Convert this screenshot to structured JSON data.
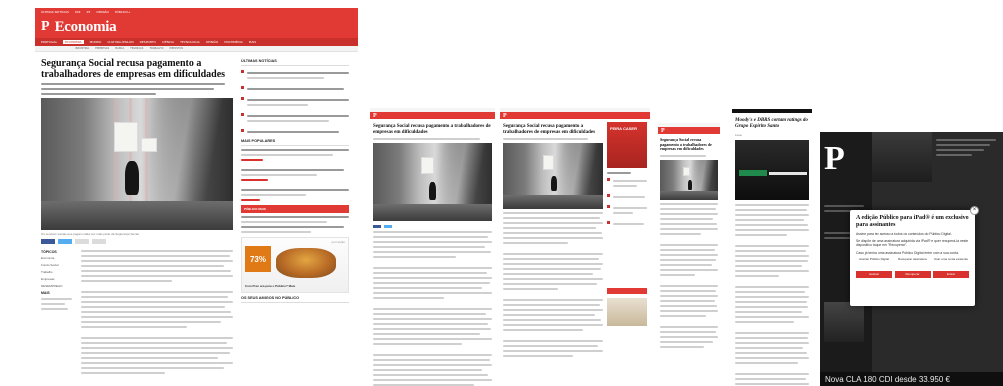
{
  "desktop": {
    "topbar": [
      "ÚLTIMAS NOTÍCIAS",
      "P24",
      "P3",
      "OPINIÃO",
      "PÚBLICO+"
    ],
    "logo": "P",
    "section": "Economia",
    "nav": [
      "PORTUGAL",
      "ECONOMIA",
      "MUNDO",
      "CULTURA-ÍPSILON",
      "DESPORTO",
      "CIÊNCIA",
      "TECNOLOGIA",
      "OPINIÃO",
      "MULTIMÉDIA",
      "MAIS"
    ],
    "subnav": [
      "INDÚSTRIA",
      "EMPRESAS",
      "BANCA",
      "FINANÇAS",
      "TRABALHO",
      "IMPOSTOS"
    ],
    "article": {
      "title": "Segurança Social recusa pagamento a trabalhadores de empresas em dificuldades",
      "caption": "Os serviços sociais que pagam cada vez mais parte da Segurança Social"
    },
    "tags_label": "TÓPICOS",
    "tags": [
      "Economia",
      "Fundo Social",
      "Trabalho",
      "Empresas",
      "DESEMPREGO"
    ],
    "more_label": "MAIS",
    "sidebar": {
      "latest_label": "ÚLTIMAS NOTÍCIAS",
      "popular_label": "MAIS POPULARES",
      "promo_label": "PÚBLICO MAIS",
      "ad": {
        "percent": "73%",
        "tag": "promoção",
        "text": "Com Pren ara para o Público? Mais"
      },
      "bottom_label": "OS SEUS AMIGOS NO PÚBLICO"
    }
  },
  "tablet1": {
    "logo": "P",
    "title": "Segurança Social recusa pagamento a trabalhadores de empresas em dificuldades"
  },
  "tablet2": {
    "logo": "P",
    "title": "Segurança Social recusa pagamento a trabalhadores de empresas em dificuldades",
    "ad_label": "FEIRA CASER"
  },
  "phone1": {
    "logo": "P",
    "title": "Segurança Social recusa pagamento a trabalhadores de empresas em dificuldades"
  },
  "phone2": {
    "title": "Moody's e DBRS cortam ratings do Grupo Espírito Santo",
    "byline": "Lusa"
  },
  "ipad": {
    "logo": "P",
    "modal": {
      "title": "A edição Público para iPad® é um exclusivo para assinantes",
      "body1": "Assine para ter acesso a todos os conteúdos do Público Digital.",
      "body2": "Se dispõe de uma assinatura adquirida via iPad® e quer recuperá-la neste dispositivo toque em \"Recuperar\".",
      "body3": "Caso já tenha uma assinatura Público Digital entre com a sua conta.",
      "options": [
        {
          "text": "Assinar Público Digital",
          "button": "Assinar"
        },
        {
          "text": "Recuperar assinatura",
          "button": "Recuperar"
        },
        {
          "text": "Usar uma conta existente",
          "button": "Entrar"
        }
      ]
    },
    "footer": "Nova CLA 180 CDI desde 33.950 €"
  }
}
